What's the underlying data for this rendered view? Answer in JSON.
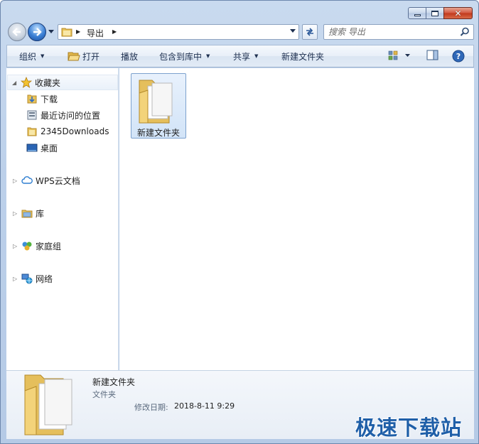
{
  "window": {
    "caption_buttons": {
      "minimize_icon": "minimize-icon",
      "maximize_icon": "maximize-icon",
      "close_icon": "close-icon"
    }
  },
  "navigation": {
    "back_icon": "back-arrow-icon",
    "forward_icon": "forward-arrow-icon",
    "address": {
      "crumb": "导出"
    },
    "search": {
      "placeholder": "搜索 导出"
    }
  },
  "toolbar": {
    "organize": "组织",
    "open": "打开",
    "play": "播放",
    "include_in_library": "包含到库中",
    "share": "共享",
    "new_folder": "新建文件夹"
  },
  "nav_pane": {
    "favorites": {
      "label": "收藏夹",
      "items": [
        {
          "label": "下载",
          "icon": "download-folder-icon"
        },
        {
          "label": "最近访问的位置",
          "icon": "recent-places-icon"
        },
        {
          "label": "2345Downloads",
          "icon": "folder-icon"
        },
        {
          "label": "桌面",
          "icon": "desktop-icon"
        }
      ]
    },
    "groups": [
      {
        "label": "WPS云文档",
        "icon": "cloud-icon"
      },
      {
        "label": "库",
        "icon": "library-icon"
      },
      {
        "label": "家庭组",
        "icon": "homegroup-icon"
      },
      {
        "label": "网络",
        "icon": "network-icon"
      }
    ]
  },
  "content": {
    "items": [
      {
        "name": "新建文件夹",
        "icon": "folder-icon"
      }
    ]
  },
  "details": {
    "name": "新建文件夹",
    "type": "文件夹",
    "date_label": "修改日期:",
    "date_value": "2018-8-11 9:29",
    "watermark": "极速下载站"
  },
  "colors": {
    "accent": "#1f5fa8",
    "selection": "#d2e4f8",
    "chrome": "#bcd0ea"
  }
}
